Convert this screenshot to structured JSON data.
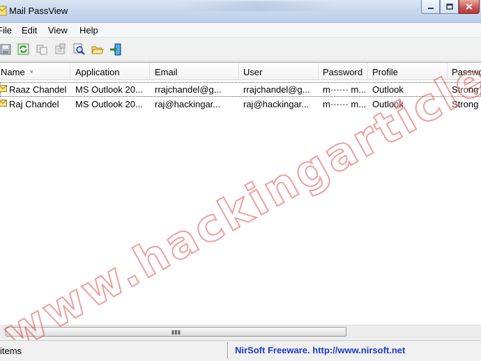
{
  "window": {
    "title": "Mail PassView",
    "controls": [
      "minimize",
      "maximize",
      "close"
    ]
  },
  "menu": {
    "items": [
      "File",
      "Edit",
      "View",
      "Help"
    ]
  },
  "toolbar": {
    "buttons": [
      "save-icon",
      "refresh-icon",
      "copy-icon",
      "properties-icon",
      "find-icon",
      "open-folder-icon",
      "exit-icon"
    ]
  },
  "table": {
    "columns": [
      "Name",
      "Application",
      "Email",
      "User",
      "Password",
      "Profile",
      "Passwo"
    ],
    "sorted_column": "Name",
    "rows": [
      {
        "name": "Raaz Chandel",
        "application": "MS Outlook 20...",
        "email": "rrajchandel@g...",
        "user": "rrajchandel@g...",
        "password": "m······ m...",
        "profile": "Outlook",
        "strength": "Strong"
      },
      {
        "name": "Raj Chandel",
        "application": "MS Outlook 20...",
        "email": "raj@hackingar...",
        "user": "raj@hackingar...",
        "password": "m······ m...",
        "profile": "Outlook",
        "strength": "Strong"
      }
    ]
  },
  "statusbar": {
    "left": "items",
    "right": "NirSoft Freeware.  http://www.nirsoft.net"
  },
  "watermark": {
    "text": "www.hackingarticles.in"
  },
  "colors": {
    "status_link": "#1a3cc8",
    "watermark": "#dc2828"
  }
}
